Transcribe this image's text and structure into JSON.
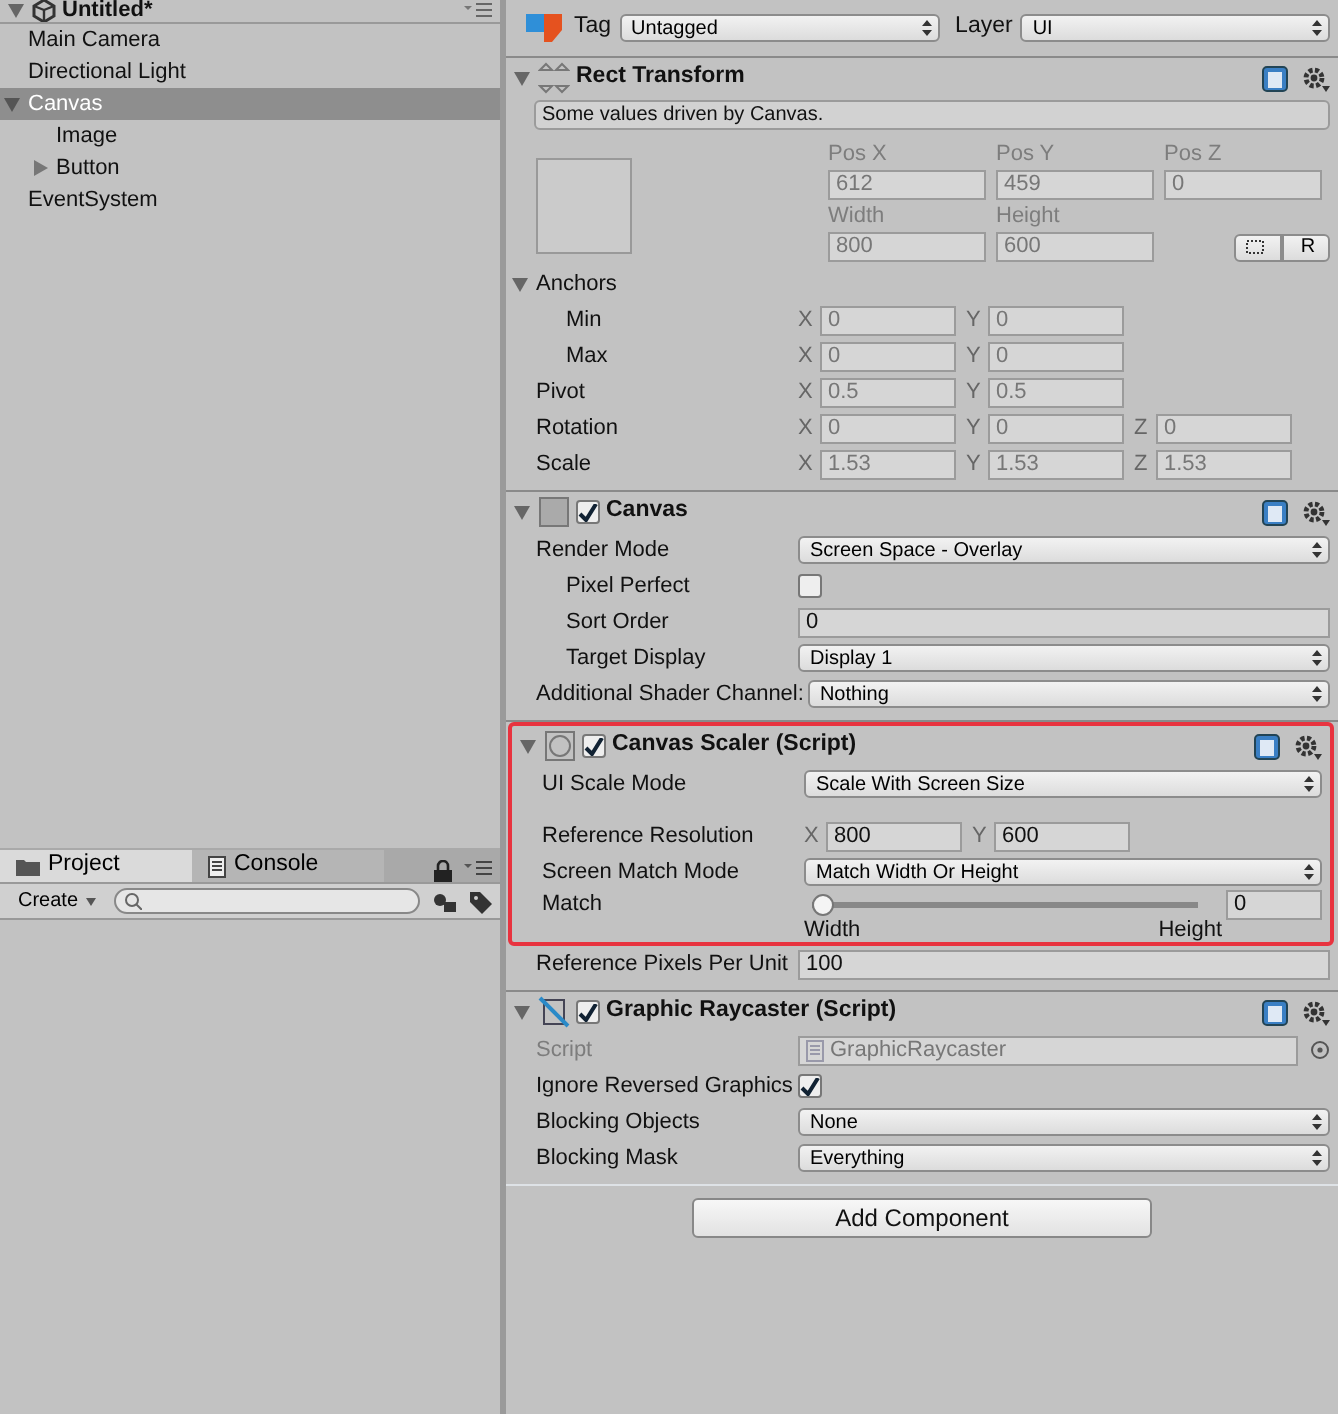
{
  "hierarchy": {
    "title": "Untitled*",
    "items": [
      {
        "label": "Main Camera",
        "selected": false
      },
      {
        "label": "Directional Light",
        "selected": false
      },
      {
        "label": "Canvas",
        "selected": true,
        "expanded": true,
        "children": [
          {
            "label": "Image",
            "selected": false
          },
          {
            "label": "Button",
            "selected": false,
            "expanded": false
          }
        ]
      },
      {
        "label": "EventSystem",
        "selected": false
      }
    ]
  },
  "project_panel": {
    "tabs": [
      {
        "label": "Project",
        "selected": true
      },
      {
        "label": "Console",
        "selected": false
      }
    ],
    "create_button": "Create"
  },
  "inspector": {
    "tag_label": "Tag",
    "tag": "Untagged",
    "layer_label": "Layer",
    "layer": "UI",
    "components": [
      {
        "title": "Rect Transform",
        "expanded": true,
        "help": "Some values driven by Canvas.",
        "grid": [
          [
            {
              "label": "Pos X",
              "value": "612"
            },
            {
              "label": "Pos Y",
              "value": "459"
            },
            {
              "label": "Pos Z",
              "value": "0"
            }
          ],
          [
            {
              "label": "Width",
              "value": "800"
            },
            {
              "label": "Height",
              "value": "600"
            }
          ]
        ],
        "raw_button": "R",
        "rows": [
          {
            "kind": "foldout",
            "label": "Anchors",
            "expanded": true,
            "children": [
              {
                "kind": "vector",
                "label": "Min",
                "disabled": true,
                "fields": [
                  {
                    "axis": "X",
                    "value": "0"
                  },
                  {
                    "axis": "Y",
                    "value": "0"
                  }
                ]
              },
              {
                "kind": "vector",
                "label": "Max",
                "disabled": true,
                "fields": [
                  {
                    "axis": "X",
                    "value": "0"
                  },
                  {
                    "axis": "Y",
                    "value": "0"
                  }
                ]
              }
            ]
          },
          {
            "kind": "vector",
            "label": "Pivot",
            "disabled": true,
            "fields": [
              {
                "axis": "X",
                "value": "0.5"
              },
              {
                "axis": "Y",
                "value": "0.5"
              }
            ]
          },
          {
            "kind": "vector",
            "label": "Rotation",
            "disabled": true,
            "fields": [
              {
                "axis": "X",
                "value": "0"
              },
              {
                "axis": "Y",
                "value": "0"
              },
              {
                "axis": "Z",
                "value": "0"
              }
            ]
          },
          {
            "kind": "vector",
            "label": "Scale",
            "disabled": true,
            "fields": [
              {
                "axis": "X",
                "value": "1.53"
              },
              {
                "axis": "Y",
                "value": "1.53"
              },
              {
                "axis": "Z",
                "value": "1.53"
              }
            ]
          }
        ]
      },
      {
        "title": "Canvas",
        "expanded": true,
        "enabled": true,
        "rows": [
          {
            "kind": "dropdown",
            "label": "Render Mode",
            "value": "Screen Space - Overlay",
            "children": [
              {
                "kind": "checkbox",
                "label": "Pixel Perfect",
                "checked": false
              },
              {
                "kind": "text",
                "label": "Sort Order",
                "value": "0"
              },
              {
                "kind": "dropdown",
                "label": "Target Display",
                "value": "Display 1"
              }
            ]
          },
          {
            "kind": "dropdown",
            "label": "Additional Shader Channel:",
            "value": "Nothing"
          }
        ]
      },
      {
        "title": "Canvas Scaler (Script)",
        "expanded": true,
        "enabled": true,
        "highlighted": true,
        "rows": [
          {
            "kind": "dropdown",
            "label": "UI Scale Mode",
            "value": "Scale With Screen Size",
            "highlighted": true
          },
          {
            "kind": "vector",
            "label": "Reference Resolution",
            "gap_before": true,
            "highlighted": true,
            "fields": [
              {
                "axis": "X",
                "value": "800"
              },
              {
                "axis": "Y",
                "value": "600"
              }
            ]
          },
          {
            "kind": "dropdown",
            "label": "Screen Match Mode",
            "value": "Match Width Or Height",
            "highlighted": true
          },
          {
            "kind": "slider",
            "label": "Match",
            "level": 0,
            "value": "0",
            "min_label": "Width",
            "max_label": "Height",
            "highlighted": true
          },
          {
            "kind": "text",
            "label": "Reference Pixels Per Unit",
            "value": "100"
          }
        ]
      },
      {
        "title": "Graphic Raycaster (Script)",
        "expanded": true,
        "enabled": true,
        "rows": [
          {
            "kind": "object",
            "label": "Script",
            "value": "GraphicRaycaster",
            "disabled": true
          },
          {
            "kind": "checkbox",
            "label": "Ignore Reversed Graphics",
            "checked": true
          },
          {
            "kind": "dropdown",
            "label": "Blocking Objects",
            "value": "None"
          },
          {
            "kind": "dropdown",
            "label": "Blocking Mask",
            "value": "Everything"
          }
        ]
      }
    ],
    "add_button": "Add Component"
  }
}
